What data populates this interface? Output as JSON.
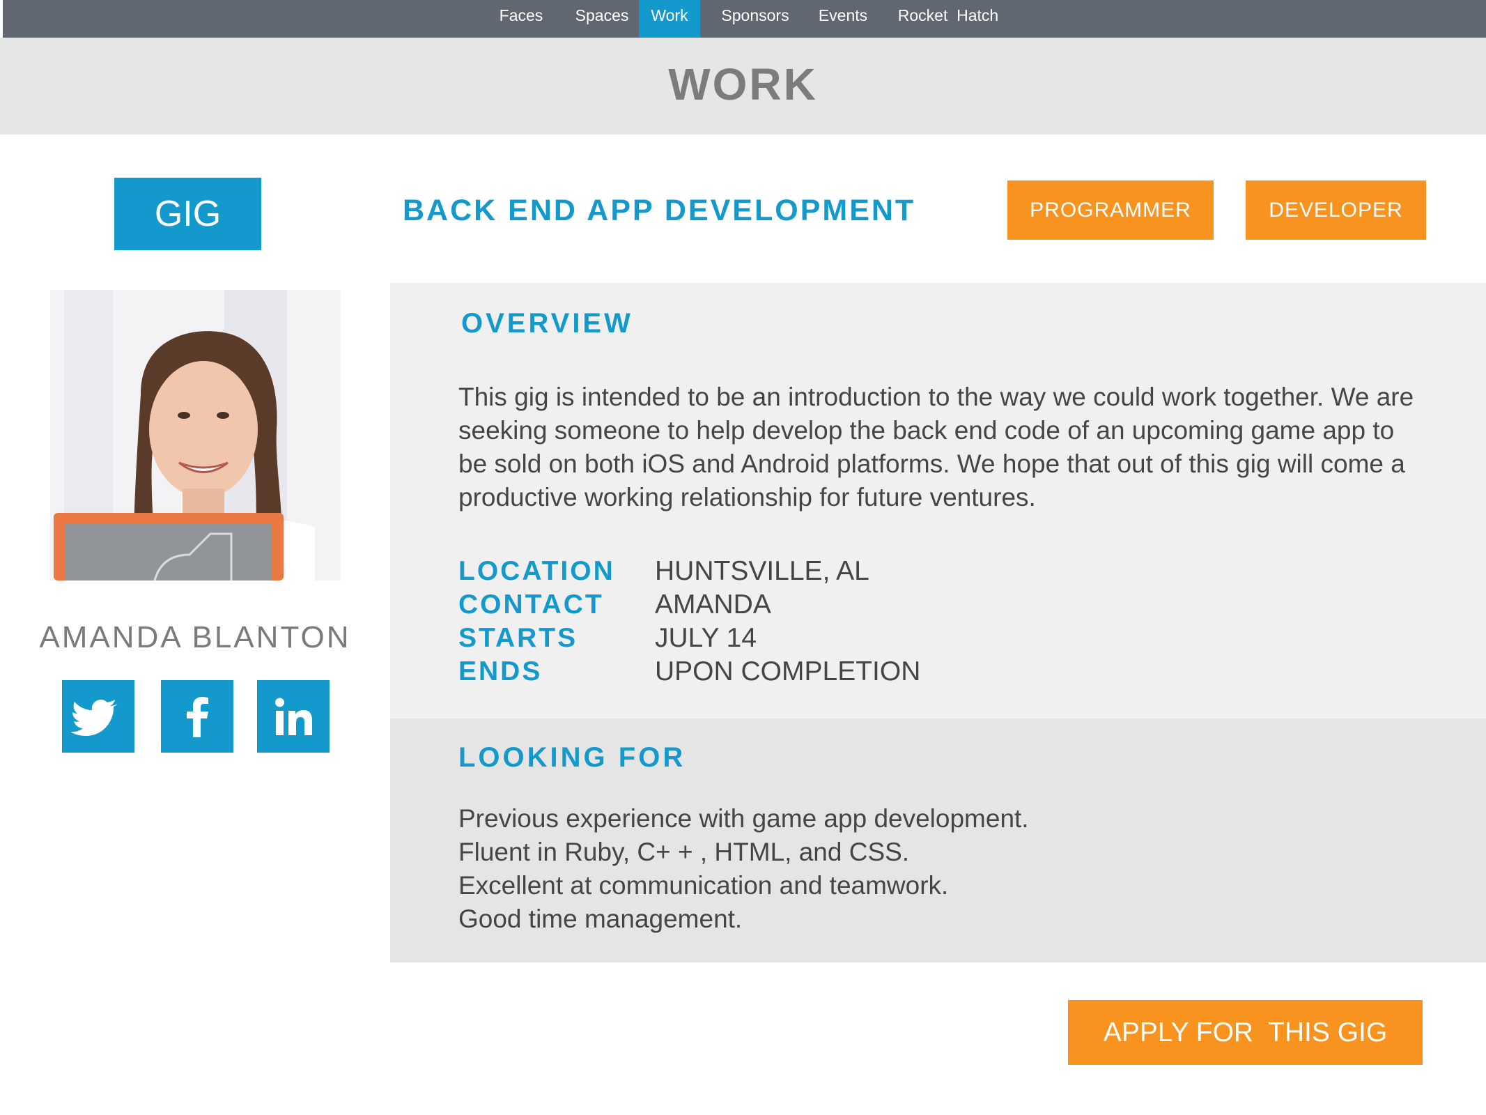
{
  "nav": {
    "items": [
      {
        "label": "Faces",
        "active": false
      },
      {
        "label": "Spaces",
        "active": false
      },
      {
        "label": "Work",
        "active": true
      },
      {
        "label": "Sponsors",
        "active": false
      },
      {
        "label": "Events",
        "active": false
      },
      {
        "label": "Rocket  Hatch",
        "active": false
      }
    ]
  },
  "page_title": "WORK",
  "gig": {
    "badge": "GIG",
    "title": "BACK END APP DEVELOPMENT",
    "tags": [
      "PROGRAMMER",
      "DEVELOPER"
    ]
  },
  "profile": {
    "name": "AMANDA BLANTON",
    "social": [
      "twitter-icon",
      "facebook-icon",
      "linkedin-icon"
    ]
  },
  "overview": {
    "heading": "OVERVIEW",
    "text": "This gig is intended to be an introduction to the way we could work together. We are seeking someone to help develop the back end code of an upcoming game app to be sold on both iOS and Android platforms. We hope that out of this gig will come a productive working relationship for future ventures.",
    "details": [
      {
        "label": "LOCATION",
        "value": "HUNTSVILLE, AL"
      },
      {
        "label": "CONTACT",
        "value": "AMANDA"
      },
      {
        "label": "STARTS",
        "value": "JULY 14"
      },
      {
        "label": "ENDS",
        "value": "UPON COMPLETION"
      }
    ]
  },
  "looking_for": {
    "heading": "LOOKING FOR",
    "items": [
      "Previous experience with game app development.",
      "Fluent in Ruby, C+ + , HTML, and CSS.",
      "Excellent at communication and teamwork.",
      "Good time management."
    ]
  },
  "apply_label": "APPLY FOR  THIS GIG",
  "colors": {
    "nav_bg": "#616770",
    "accent_blue": "#1499cc",
    "accent_orange": "#f7931e",
    "title_band": "#e6e6e6",
    "panel_light": "#f0f0f0",
    "panel_dark": "#e5e5e5"
  }
}
